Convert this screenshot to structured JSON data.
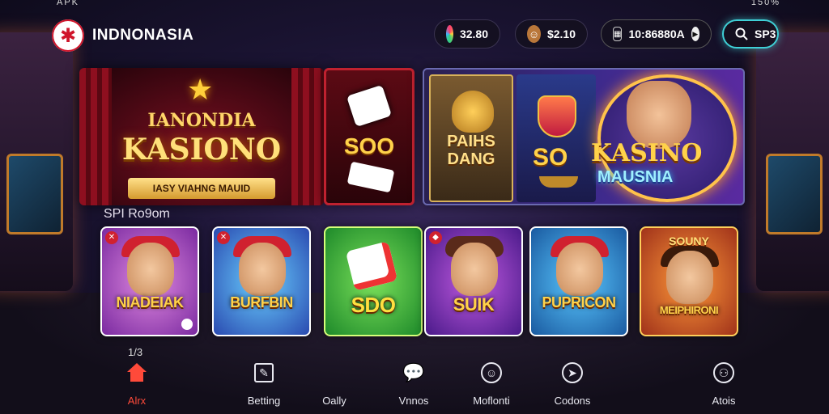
{
  "status_bar": {
    "left": "APK",
    "right": "150%"
  },
  "header": {
    "brand": "INDNONASIA",
    "balances": [
      {
        "icon": "prize-wheel-icon",
        "value": "32.80"
      },
      {
        "icon": "avatar-icon",
        "value": "$2.10"
      },
      {
        "icon": "wallet-icon",
        "value": "10:86880A"
      }
    ],
    "search_label": "SP3"
  },
  "banners": {
    "main": {
      "title_top": "IANONDIA",
      "title": "KASIONO",
      "tagline": "IASY VIAHNG MAUID"
    },
    "dice": {
      "label": "SOO"
    },
    "slot_left": {
      "label": "PAIHS DANG"
    },
    "slot_mid": {
      "label": "SO"
    },
    "feature": {
      "title": "KASINO",
      "subtitle": "MAUSNIA"
    }
  },
  "section": {
    "title": "SPI Ro9om"
  },
  "games": [
    {
      "name": "NIADEIAK"
    },
    {
      "name": "BURFBIN"
    },
    {
      "name": "SDO"
    },
    {
      "name": "SUIK"
    },
    {
      "name": "PUPRICON"
    },
    {
      "top": "SOUNY",
      "name": "MEIPHIRONI"
    }
  ],
  "page_indicator": "1/3",
  "nav": [
    {
      "label": "Alrx",
      "icon": "home-icon"
    },
    {
      "label": "Betting",
      "icon": "edit-icon"
    },
    {
      "label": "Oally",
      "icon": ""
    },
    {
      "label": "Vnnos",
      "icon": "chat-icon"
    },
    {
      "label": "Moflonti",
      "icon": "smile-icon"
    },
    {
      "label": "Codons",
      "icon": "compass-icon"
    },
    {
      "label": "Atois",
      "icon": "profile-icon"
    }
  ],
  "colors": {
    "accent": "#3fd0d6",
    "active": "#ff4a3a",
    "gold": "#ffd24a"
  }
}
